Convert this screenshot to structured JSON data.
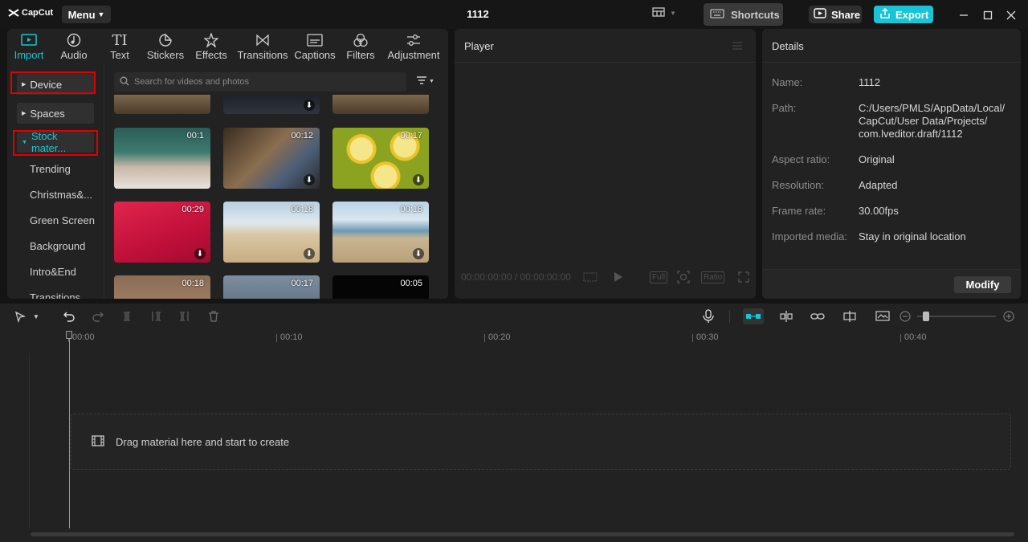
{
  "app": {
    "name": "CapCut",
    "menu_label": "Menu",
    "project_title": "1112"
  },
  "topbar": {
    "shortcuts_label": "Shortcuts",
    "share_label": "Share",
    "export_label": "Export",
    "accent_color": "#19c4d6"
  },
  "media": {
    "tabs": [
      {
        "label": "Import",
        "icon": "import-icon",
        "active": true
      },
      {
        "label": "Audio",
        "icon": "audio-icon"
      },
      {
        "label": "Text",
        "icon": "text-icon"
      },
      {
        "label": "Stickers",
        "icon": "stickers-icon"
      },
      {
        "label": "Effects",
        "icon": "effects-icon"
      },
      {
        "label": "Transitions",
        "icon": "transitions-icon"
      },
      {
        "label": "Captions",
        "icon": "captions-icon"
      },
      {
        "label": "Filters",
        "icon": "filters-icon"
      },
      {
        "label": "Adjustment",
        "icon": "adjustment-icon"
      }
    ],
    "sidebar": {
      "device_label": "Device",
      "spaces_label": "Spaces",
      "stock_label": "Stock mater...",
      "items": [
        "Trending",
        "Christmas&...",
        "Green Screen",
        "Background",
        "Intro&End",
        "Transitions"
      ]
    },
    "search_placeholder": "Search for videos and photos",
    "thumbnails": [
      {
        "duration": "",
        "scene": "room"
      },
      {
        "duration": "",
        "scene": "dark-legs"
      },
      {
        "duration": "",
        "scene": "room"
      },
      {
        "duration": "00:1",
        "scene": "classroom"
      },
      {
        "duration": "00:12",
        "scene": "living-room"
      },
      {
        "duration": "00:17",
        "scene": "lemons"
      },
      {
        "duration": "00:29",
        "scene": "red-dancer"
      },
      {
        "duration": "00:18",
        "scene": "beach-dogs"
      },
      {
        "duration": "00:18",
        "scene": "beach-shore"
      },
      {
        "duration": "00:18",
        "scene": "warm"
      },
      {
        "duration": "00:17",
        "scene": "car"
      },
      {
        "duration": "00:05",
        "scene": "black"
      }
    ]
  },
  "player": {
    "title": "Player",
    "timecode": "00:00:00:00 / 00:00:00:00",
    "full_label": "Full",
    "ratio_label": "Ratio"
  },
  "details": {
    "title": "Details",
    "rows": [
      {
        "label": "Name:",
        "value": "1112"
      },
      {
        "label": "Path:",
        "value": "C:/Users/PMLS/AppData/Local/ CapCut/User Data/Projects/ com.lveditor.draft/1112"
      },
      {
        "label": "Aspect ratio:",
        "value": "Original"
      },
      {
        "label": "Resolution:",
        "value": "Adapted"
      },
      {
        "label": "Frame rate:",
        "value": "30.00fps"
      },
      {
        "label": "Imported media:",
        "value": "Stay in original location"
      }
    ],
    "modify_label": "Modify"
  },
  "timeline": {
    "ruler": [
      "00:00",
      "00:10",
      "00:20",
      "00:30",
      "00:40"
    ],
    "drop_hint": "Drag material here and start to create"
  }
}
